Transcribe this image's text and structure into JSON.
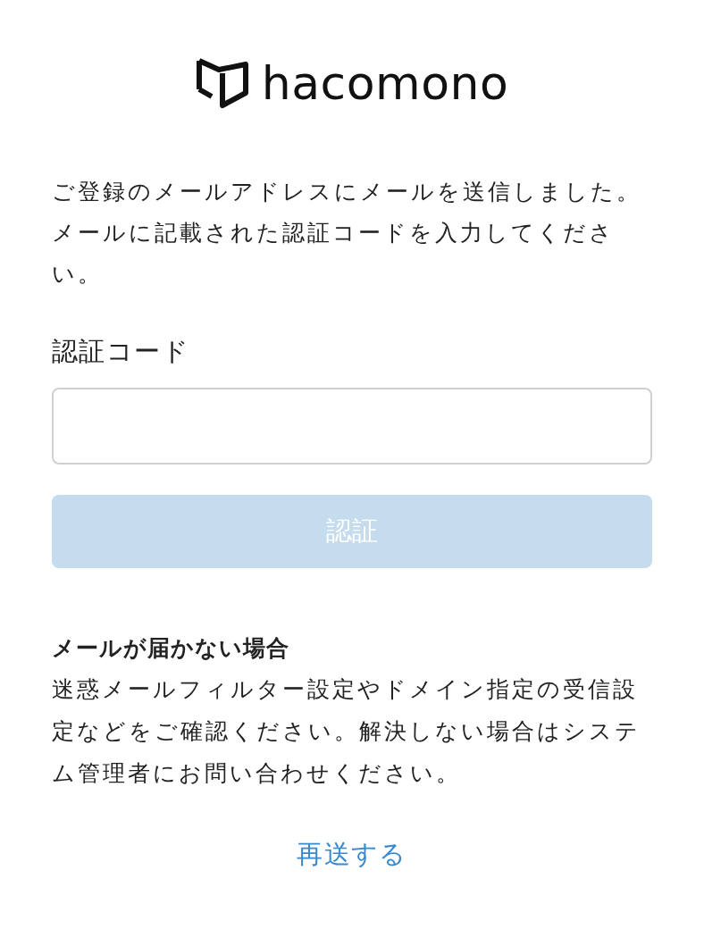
{
  "logo": {
    "text": "hacomono"
  },
  "message": "ご登録のメールアドレスにメールを送信しました。メールに記載された認証コードを入力してください。",
  "code_field": {
    "label": "認証コード"
  },
  "submit_button": {
    "label": "認証",
    "disabled": true
  },
  "help": {
    "title": "メールが届かない場合",
    "body": "迷惑メールフィルター設定やドメイン指定の受信設定などをご確認ください。解決しない場合はシステム管理者にお問い合わせください。"
  },
  "resend_link": "再送する"
}
